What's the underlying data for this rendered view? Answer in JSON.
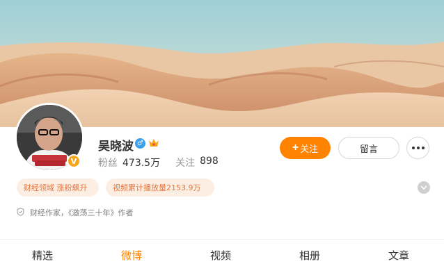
{
  "profile": {
    "name": "吴晓波",
    "fans_label": "粉丝",
    "fans_value": "473.5万",
    "following_label": "关注",
    "following_value": "898",
    "bio": "财经作家，《激荡三十年》作者"
  },
  "actions": {
    "follow_label": "关注",
    "message_label": "留言"
  },
  "tags": [
    {
      "label": "财经领域 涨粉飙升"
    },
    {
      "label": "视频累计播放量2153.9万"
    }
  ],
  "tabs": [
    {
      "label": "精选"
    },
    {
      "label": "微博",
      "active": true
    },
    {
      "label": "视频"
    },
    {
      "label": "相册"
    },
    {
      "label": "文章"
    }
  ],
  "colors": {
    "accent": "#ff8200",
    "tag_bg": "#fdeee4",
    "tag_text": "#e4763b",
    "verified": "#f7a51c",
    "gender_male": "#3aa0f0"
  },
  "icons": [
    "male-gender-icon",
    "crown-icon",
    "verified-v-icon",
    "more-dots-icon",
    "chevron-down-icon",
    "shield-icon"
  ]
}
